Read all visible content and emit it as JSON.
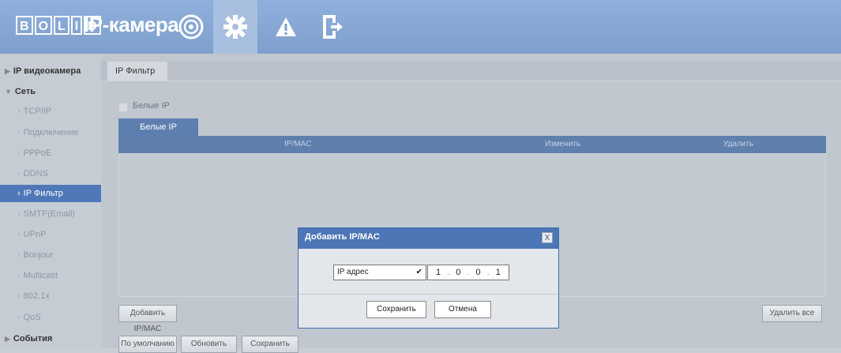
{
  "header": {
    "logo": [
      "B",
      "O",
      "L",
      "I",
      "D"
    ],
    "title": "IP-камера",
    "icons": [
      "eye-icon",
      "gear-icon",
      "warning-icon",
      "exit-icon"
    ]
  },
  "sidebar": {
    "camera_label": "IP видеокамера",
    "network_label": "Сеть",
    "events_label": "События",
    "items": [
      "TCP/IP",
      "Подключение",
      "PPPoE",
      "DDNS",
      "IP Фильтр",
      "SMTP(Email)",
      "UPnP",
      "Bonjour",
      "Multicast",
      "802.1x",
      "QoS"
    ],
    "active_index": 4
  },
  "main": {
    "tab": "IP Фильтр",
    "checkbox_label": "Белые IP",
    "subtab": "Белые IP",
    "columns": [
      "IP/MAC",
      "Изменить",
      "Удалить"
    ],
    "add_button": "Добавить IP/MAC",
    "delete_all_button": "Удалить все",
    "default_button": "По умолчанию",
    "refresh_button": "Обновить",
    "save_button": "Сохранить"
  },
  "dialog": {
    "title": "Добавить IP/MAC",
    "close": "X",
    "type_value": "IP адрес",
    "ip": [
      "1",
      "0",
      "0",
      "1"
    ],
    "save": "Сохранить",
    "cancel": "Отмена"
  },
  "colors": {
    "header": "#7e9fcc",
    "accent": "#4f78b8",
    "dialog_title": "#4c76b5"
  }
}
